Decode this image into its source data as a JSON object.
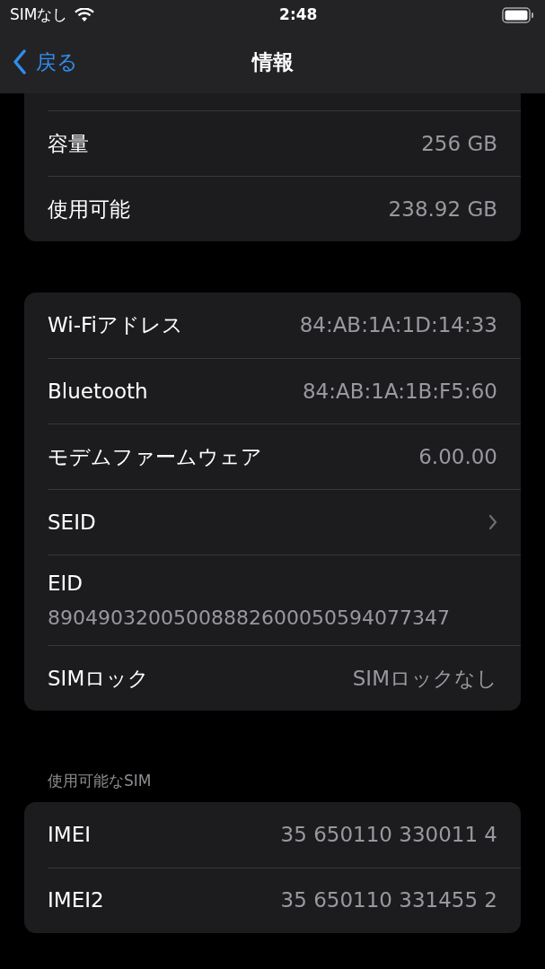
{
  "status_bar": {
    "carrier": "SIMなし",
    "time": "2:48"
  },
  "nav": {
    "back": "戻る",
    "title": "情報"
  },
  "groups": [
    {
      "cut_top": true,
      "rows": [
        {
          "kind": "value",
          "label": "容量",
          "value": "256 GB"
        },
        {
          "kind": "value",
          "label": "使用可能",
          "value": "238.92 GB"
        }
      ]
    },
    {
      "rows": [
        {
          "kind": "value",
          "label": "Wi-Fiアドレス",
          "value": "84:AB:1A:1D:14:33"
        },
        {
          "kind": "value",
          "label": "Bluetooth",
          "value": "84:AB:1A:1B:F5:60"
        },
        {
          "kind": "value",
          "label": "モデムファームウェア",
          "value": "6.00.00"
        },
        {
          "kind": "link",
          "label": "SEID"
        },
        {
          "kind": "stacked",
          "label": "EID",
          "value": "89049032005008882600050594077347"
        },
        {
          "kind": "value",
          "label": "SIMロック",
          "value": "SIMロックなし"
        }
      ]
    },
    {
      "header": "使用可能なSIM",
      "rows": [
        {
          "kind": "value",
          "label": "IMEI",
          "value": "35 650110 330011 4"
        },
        {
          "kind": "value",
          "label": "IMEI2",
          "value": "35 650110 331455 2"
        }
      ]
    }
  ]
}
